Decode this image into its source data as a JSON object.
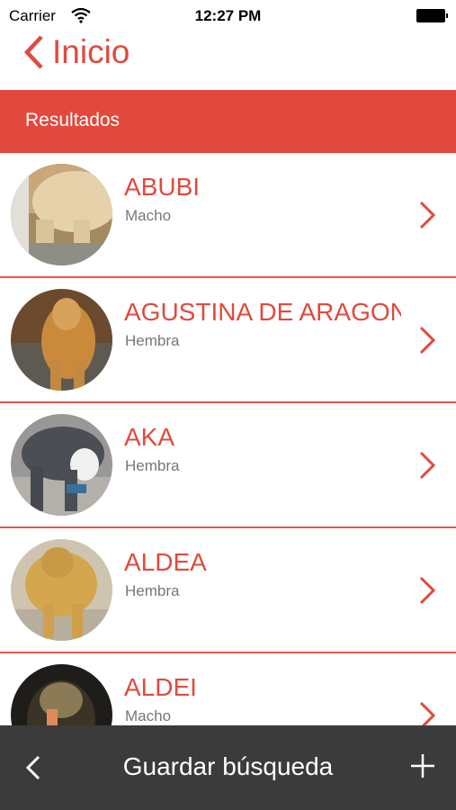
{
  "status_bar": {
    "carrier": "Carrier",
    "time": "12:27 PM"
  },
  "nav": {
    "back_label": "Inicio"
  },
  "section": {
    "title": "Resultados"
  },
  "results": [
    {
      "name": "ABUBI",
      "sex": "Macho"
    },
    {
      "name": "AGUSTINA DE ARAGON",
      "sex": "Hembra"
    },
    {
      "name": "AKA",
      "sex": "Hembra"
    },
    {
      "name": "ALDEA",
      "sex": "Hembra"
    },
    {
      "name": "ALDEI",
      "sex": "Macho"
    }
  ],
  "toolbar": {
    "title": "Guardar búsqueda"
  },
  "colors": {
    "accent": "#e2483c",
    "toolbar_bg": "#3b3b3b",
    "sex_text": "#777777"
  },
  "icons": {
    "wifi": "wifi-icon",
    "battery": "battery-icon",
    "back": "chevron-left-icon",
    "row_chevron": "chevron-right-icon",
    "toolbar_back": "chevron-left-icon",
    "add": "plus-icon"
  }
}
